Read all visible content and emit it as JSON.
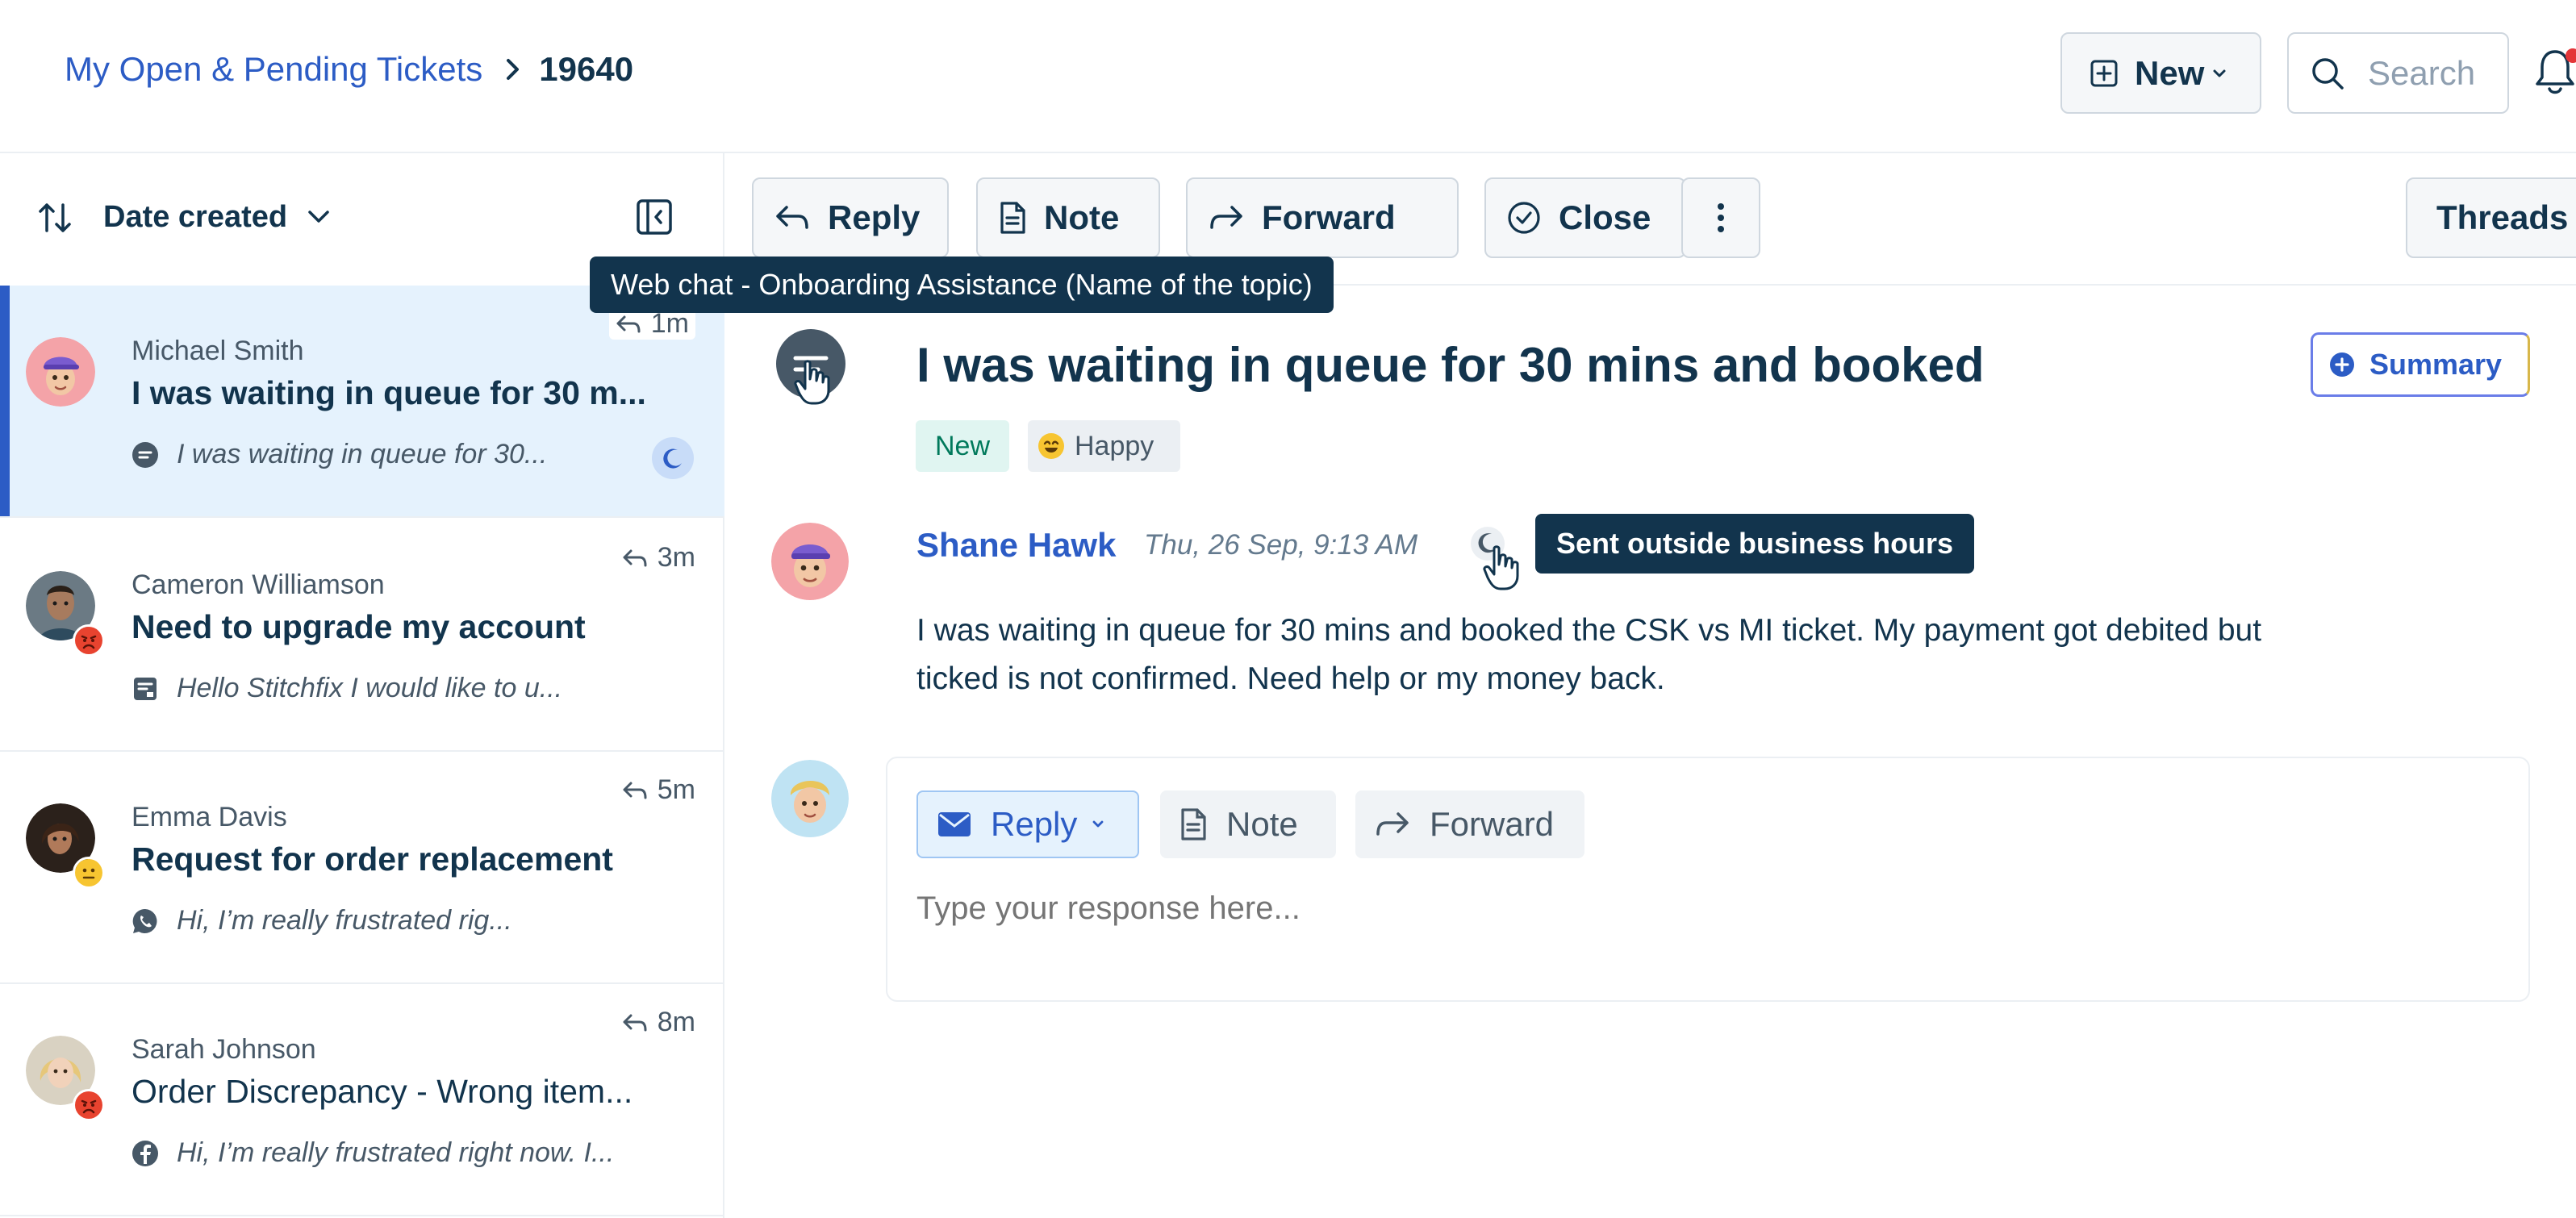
{
  "header": {
    "breadcrumb_link": "My Open & Pending Tickets",
    "breadcrumb_current": "19640",
    "new_button": "New",
    "search_placeholder": "Search"
  },
  "list": {
    "sort_label": "Date created",
    "tickets": [
      {
        "name": "Michael Smith",
        "subject": "I was waiting in queue for 30 m...",
        "preview": "I was waiting in queue for 30...",
        "time": "1m",
        "channel_icon": "chat-bubble-icon",
        "mood_icon": "none",
        "active": true
      },
      {
        "name": "Cameron Williamson",
        "subject": "Need to upgrade my account",
        "preview": "Hello Stitchfix I would like to u...",
        "time": "3m",
        "channel_icon": "form-icon",
        "mood_icon": "angry-emoji-icon",
        "active": false
      },
      {
        "name": "Emma Davis",
        "subject": "Request for order replacement",
        "preview": "Hi, I’m really frustrated rig...",
        "time": "5m",
        "channel_icon": "whatsapp-icon",
        "mood_icon": "neutral-emoji-icon",
        "active": false
      },
      {
        "name": "Sarah Johnson",
        "subject": "Order Discrepancy - Wrong item...",
        "preview": "Hi, I’m really frustrated right now. I...",
        "time": "8m",
        "channel_icon": "facebook-icon",
        "mood_icon": "angry-emoji-icon",
        "active": false
      }
    ]
  },
  "toolbar": {
    "reply": "Reply",
    "note": "Note",
    "forward": "Forward",
    "close": "Close",
    "threads": "Threads"
  },
  "tooltips": {
    "channel": "Web chat - Onboarding Assistance (Name of the topic)",
    "hours": "Sent outside business hours"
  },
  "ticket": {
    "title": "I was waiting in queue for 30 mins and booked",
    "summary_button": "Summary",
    "status_tag": "New",
    "mood_tag": "Happy",
    "message": {
      "author": "Shane Hawk",
      "time": "Thu, 26 Sep, 9:13 AM",
      "body_line1": "I was waiting in queue for 30 mins and booked the CSK vs MI ticket. My payment got debited but",
      "body_line2": "ticked is not confirmed. Need help or my money back."
    }
  },
  "composer": {
    "reply": "Reply",
    "note": "Note",
    "forward": "Forward",
    "placeholder": "Type your response here..."
  },
  "colors": {
    "primary_text": "#12344d",
    "link_blue": "#2c5cc5",
    "active_row": "#e5f2fd",
    "tooltip_bg": "#12344d",
    "new_tag_bg": "#e0f5f1",
    "new_tag_text": "#00795b"
  }
}
